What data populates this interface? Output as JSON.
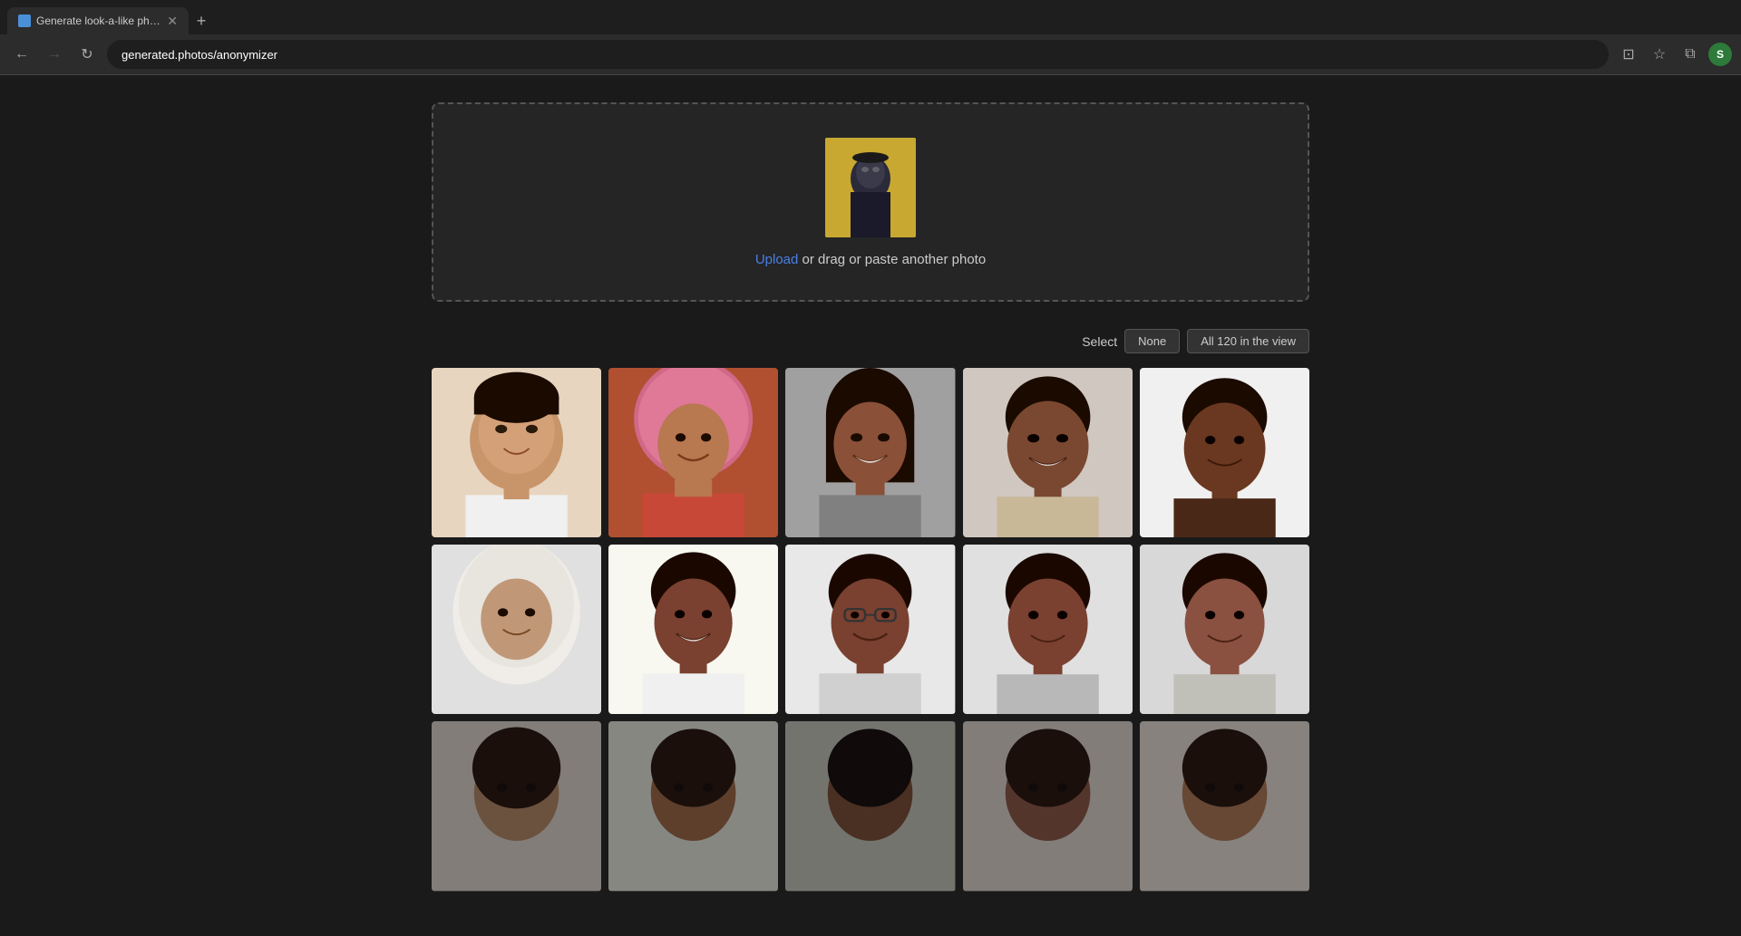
{
  "browser": {
    "tab_title": "Generate look-a-like photos to p",
    "tab_favicon": "G",
    "url": "generated.photos/anonymizer",
    "new_tab_label": "+",
    "nav": {
      "back_disabled": false,
      "forward_disabled": true
    }
  },
  "upload": {
    "text_before_link": "",
    "link_text": "Upload",
    "text_after_link": " or drag or paste another photo"
  },
  "gallery_controls": {
    "select_label": "Select",
    "none_button": "None",
    "all_button": "All 120 in the view"
  },
  "photos": [
    {
      "id": 1,
      "skin": "light-brown",
      "description": "Young girl smiling"
    },
    {
      "id": 2,
      "skin": "medium-brown",
      "description": "Woman with pink headscarf"
    },
    {
      "id": 3,
      "skin": "dark-brown",
      "description": "Young woman smiling"
    },
    {
      "id": 4,
      "skin": "dark-brown",
      "description": "Young man smiling"
    },
    {
      "id": 5,
      "skin": "dark",
      "description": "Person with short hair"
    },
    {
      "id": 6,
      "skin": "medium-light",
      "description": "Woman with white hijab"
    },
    {
      "id": 7,
      "skin": "dark-brown",
      "description": "Woman smiling"
    },
    {
      "id": 8,
      "skin": "dark-brown",
      "description": "Woman with glasses"
    },
    {
      "id": 9,
      "skin": "dark-brown",
      "description": "Woman smiling"
    },
    {
      "id": 10,
      "skin": "dark-brown",
      "description": "Woman smiling"
    },
    {
      "id": 11,
      "skin": "medium",
      "description": "Person partial"
    },
    {
      "id": 12,
      "skin": "medium-dark",
      "description": "Person partial"
    },
    {
      "id": 13,
      "skin": "dark",
      "description": "Person partial"
    },
    {
      "id": 14,
      "skin": "dark-brown",
      "description": "Person partial"
    },
    {
      "id": 15,
      "skin": "medium-brown",
      "description": "Person partial"
    }
  ],
  "page_title": "Generate look-a-like photos to protect privacy"
}
